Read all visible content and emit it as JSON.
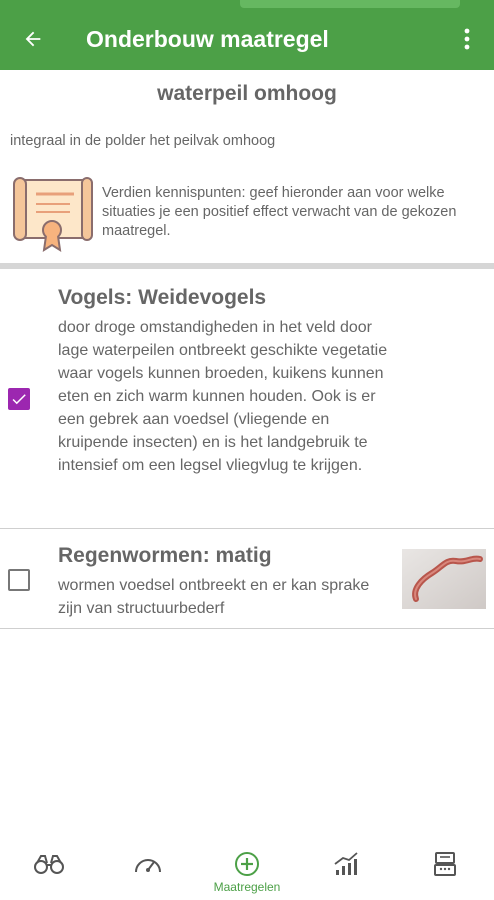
{
  "appbar": {
    "title": "Onderbouw maatregel",
    "back_icon": "arrow-left-icon",
    "menu_icon": "more-vertical-icon",
    "color": "#4ca047"
  },
  "measure": {
    "title": "waterpeil omhoog",
    "description": "integraal in de polder het peilvak omhoog"
  },
  "info": {
    "icon": "certificate-icon",
    "text": "Verdien kennispunten: geef hieronder aan voor welke situaties je een positief effect verwacht van de gekozen maatregel."
  },
  "items": [
    {
      "title": "Vogels: Weidevogels",
      "checked": true,
      "text": "door droge omstandigheden in het veld door lage waterpeilen ontbreekt geschikte vegetatie waar vogels kunnen broeden, kuikens kunnen eten en zich warm kunnen houden. Ook is er een gebrek aan voedsel (vliegende en kruipende insecten) en is het landgebruik te intensief om een legsel vliegvlug te krijgen."
    },
    {
      "title": "Regenwormen: matig",
      "checked": false,
      "text": "wormen voedsel ontbreekt en er kan sprake zijn van structuurbederf",
      "image": "earthworm-photo"
    }
  ],
  "bottom_nav": {
    "tabs": [
      {
        "icon": "binoculars-icon",
        "label": ""
      },
      {
        "icon": "speedometer-icon",
        "label": ""
      },
      {
        "icon": "plus-circle-icon",
        "label": "Maatregelen",
        "active": true
      },
      {
        "icon": "chart-growth-icon",
        "label": ""
      },
      {
        "icon": "cash-register-icon",
        "label": ""
      }
    ]
  },
  "colors": {
    "accent": "#4ca047",
    "checkbox": "#9c27b0"
  }
}
